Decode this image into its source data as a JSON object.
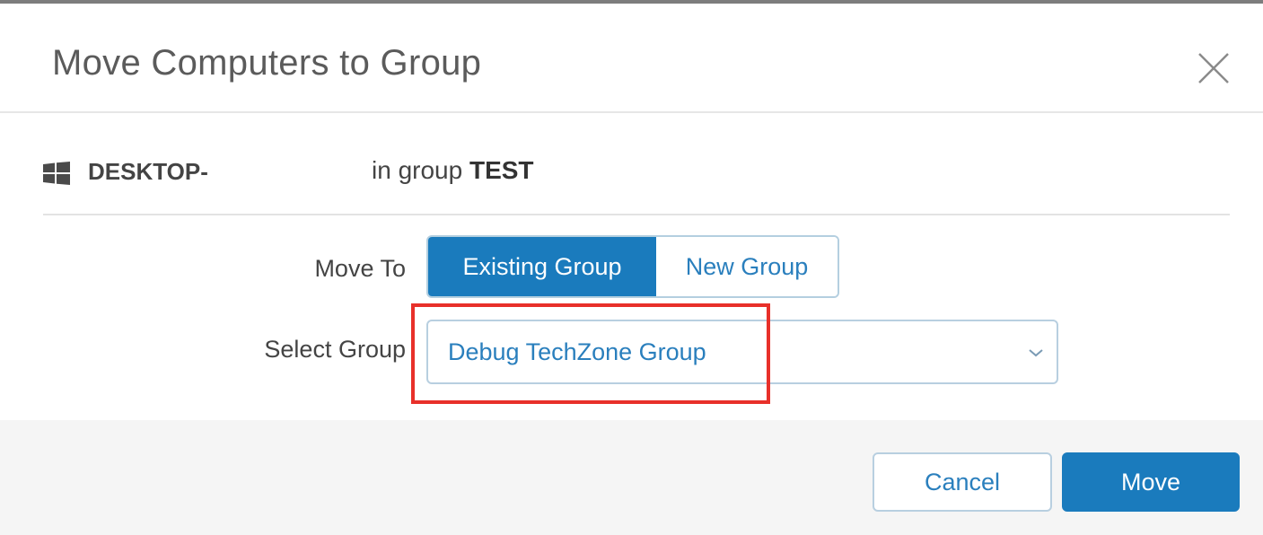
{
  "dialog": {
    "title": "Move Computers to Group",
    "close_icon": "close-icon"
  },
  "computer": {
    "os_icon": "windows-icon",
    "name": "DESKTOP-",
    "in_group_prefix": "in group",
    "group_name": "TEST"
  },
  "form": {
    "move_to_label": "Move To",
    "segments": [
      {
        "label": "Existing Group",
        "selected": true
      },
      {
        "label": "New Group",
        "selected": false
      }
    ],
    "select_group_label": "Select Group",
    "selected_group": "Debug TechZone Group",
    "dropdown_icon": "chevron-down-icon"
  },
  "footer": {
    "cancel_label": "Cancel",
    "move_label": "Move"
  },
  "colors": {
    "accent": "#1a7bbd",
    "highlight": "#e8302a"
  }
}
